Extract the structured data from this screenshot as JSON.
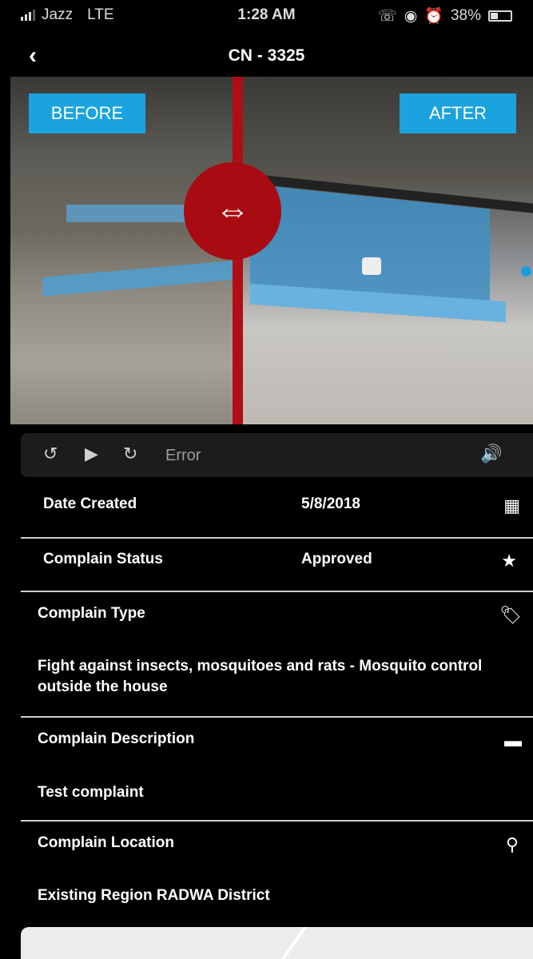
{
  "status_bar": {
    "carrier": "Jazz",
    "network": "LTE",
    "time": "1:28 AM",
    "battery": "38%"
  },
  "nav": {
    "back_icon": "chevron-left-icon",
    "title": "CN - 3325"
  },
  "compare": {
    "before_label": "BEFORE",
    "after_label": "AFTER",
    "handle_icon": "double-arrow-icon"
  },
  "player": {
    "status": "Error"
  },
  "details": {
    "date_created": {
      "label": "Date Created",
      "value": "5/8/2018",
      "icon": "calendar-icon"
    },
    "status": {
      "label": "Complain Status",
      "value": "Approved",
      "icon": "star-icon"
    },
    "type": {
      "label": "Complain Type",
      "value": "Fight against insects, mosquitoes and rats - Mosquito control outside the house",
      "icon": "tag-icon"
    },
    "description": {
      "label": "Complain Description",
      "value": "Test complaint",
      "icon": "comment-icon"
    },
    "location": {
      "label": "Complain Location",
      "value": "Existing Region RADWA District",
      "icon": "map-pin-icon"
    }
  },
  "colors": {
    "accent": "#1aa3df",
    "handle": "#a80c12",
    "background": "#000000"
  }
}
